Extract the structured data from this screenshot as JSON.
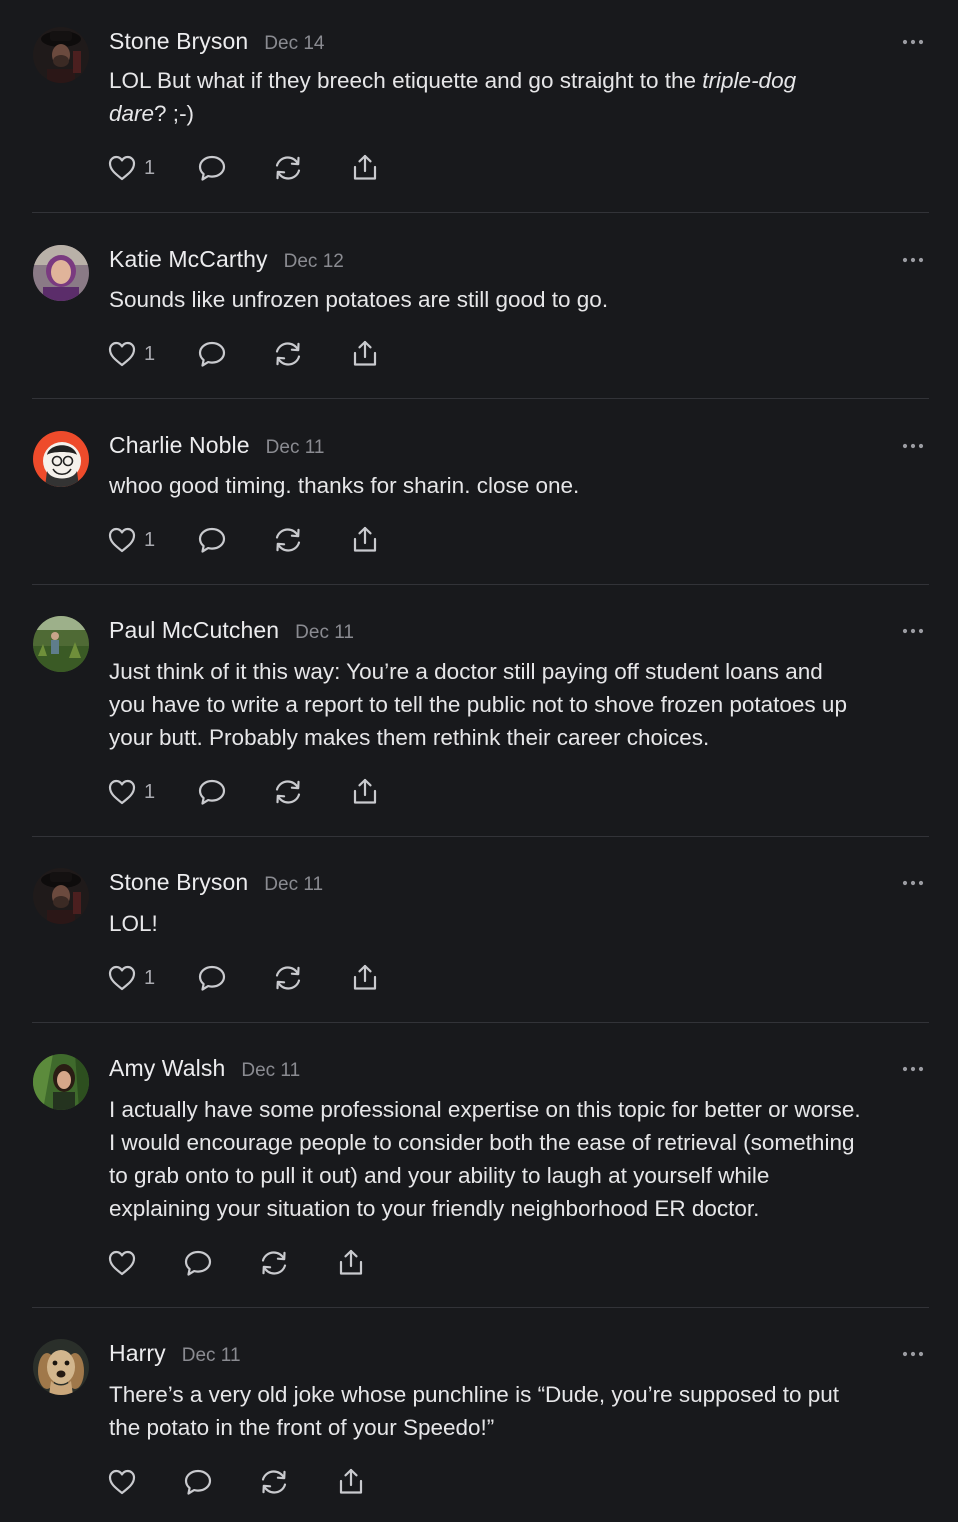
{
  "icons": {
    "like": "heart-icon",
    "reply": "speech-bubble-icon",
    "restack": "restack-arrows-icon",
    "share": "share-upload-icon",
    "more": "ellipsis-icon"
  },
  "colors": {
    "background": "#18191c",
    "divider": "#323338",
    "text": "#e6e6e8",
    "muted": "#8a8b91"
  },
  "comments": [
    {
      "author": "Stone Bryson",
      "date": "Dec 14",
      "lines": [
        [
          "LOL But what if they breech etiquette and go straight to the ",
          "triple-dog"
        ],
        [
          "dare",
          "? ;-)"
        ]
      ],
      "likes": "1"
    },
    {
      "author": "Katie McCarthy",
      "date": "Dec 12",
      "lines": [
        "Sounds like unfrozen potatoes are still good to go."
      ],
      "likes": "1"
    },
    {
      "author": "Charlie Noble",
      "date": "Dec 11",
      "lines": [
        "whoo good timing. thanks for sharin. close one."
      ],
      "likes": "1"
    },
    {
      "author": "Paul McCutchen",
      "date": "Dec 11",
      "lines": [
        "Just think of it this way: You’re a doctor still paying off student loans and",
        "you have to write a report to tell the public not to shove frozen potatoes up",
        "your butt. Probably makes them rethink their career choices."
      ],
      "likes": "1"
    },
    {
      "author": "Stone Bryson",
      "date": "Dec 11",
      "lines": [
        "LOL!"
      ],
      "likes": "1"
    },
    {
      "author": "Amy Walsh",
      "date": "Dec 11",
      "lines": [
        "I actually have some professional expertise on this topic for better or worse.",
        "I would encourage people to consider both the ease of retrieval (something",
        "to grab onto to pull it out) and your ability to laugh at yourself while",
        "explaining your situation to your friendly neighborhood ER doctor."
      ],
      "likes": ""
    },
    {
      "author": "Harry",
      "date": "Dec 11",
      "lines": [
        "There’s a very old joke whose punchline is “Dude, you’re supposed to put",
        "the potato in the front of your Speedo!”"
      ],
      "likes": ""
    }
  ]
}
